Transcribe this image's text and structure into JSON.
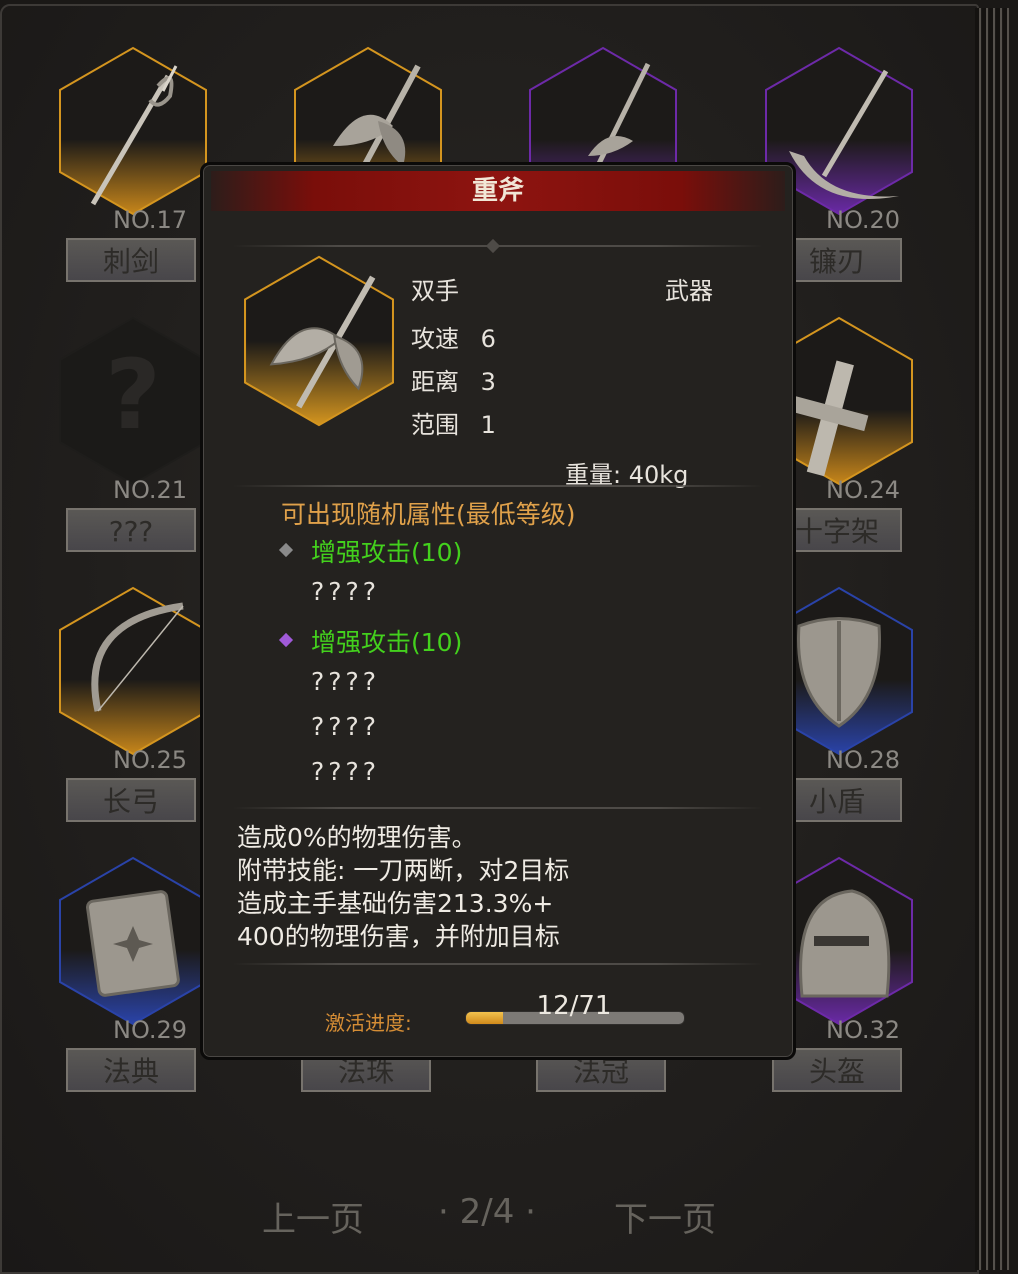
{
  "grid": {
    "cells": [
      {
        "no": "NO.17",
        "label": "刺剑",
        "icon": "rapier-icon"
      },
      {
        "no": "",
        "label": "",
        "icon": "heavy-axe-icon"
      },
      {
        "no": "",
        "label": "",
        "icon": "halberd-icon"
      },
      {
        "no": "NO.20",
        "label": "镰刃",
        "icon": "scythe-icon"
      },
      {
        "no": "NO.21",
        "label": "???",
        "icon": "unknown-question-icon"
      },
      {
        "no": "NO.24",
        "label": "十字架",
        "icon": "cross-icon"
      },
      {
        "no": "NO.25",
        "label": "长弓",
        "icon": "longbow-icon"
      },
      {
        "no": "NO.28",
        "label": "小盾",
        "icon": "small-shield-icon"
      },
      {
        "no": "NO.29",
        "label": "法典",
        "icon": "codex-icon"
      },
      {
        "no": "",
        "label": "法珠",
        "icon": "orb-icon"
      },
      {
        "no": "",
        "label": "法冠",
        "icon": "crown-icon"
      },
      {
        "no": "NO.32",
        "label": "头盔",
        "icon": "helmet-icon"
      }
    ]
  },
  "pager": {
    "prev": "上一页",
    "page": "· 2/4 ·",
    "next": "下一页"
  },
  "modal": {
    "title": "重斧",
    "icon": "heavy-axe-icon",
    "hand": "双手",
    "category": "武器",
    "stats": [
      {
        "label": "攻速",
        "value": "6"
      },
      {
        "label": "距离",
        "value": "3"
      },
      {
        "label": "范围",
        "value": "1"
      }
    ],
    "weight": "重量: 40kg",
    "attr_header": "可出现随机属性(最低等级)",
    "attrs": [
      {
        "text": "增强攻击(10)",
        "gem": "silver-gem-icon",
        "gem_color": "#8a8a8a"
      },
      {
        "text": "????"
      },
      {
        "text": "增强攻击(10)",
        "gem": "purple-gem-icon",
        "gem_color": "#a05ad8"
      },
      {
        "text": "????"
      },
      {
        "text": "????"
      },
      {
        "text": "????"
      }
    ],
    "description": [
      "造成0%的物理伤害。",
      "附带技能: 一刀两断，对2目标",
      "造成主手基础伤害213.3%+",
      "400的物理伤害，并附加目标"
    ],
    "progress_label": "激活进度:",
    "progress_text": "12/71",
    "progress_value": 0.169
  },
  "colors": {
    "gold": "#d4951f",
    "blue": "#2a43a8",
    "purple": "#6d2aa8",
    "title_red": "#8e1410",
    "attr_green": "#43d11d",
    "attr_orange": "#e0a14a"
  }
}
